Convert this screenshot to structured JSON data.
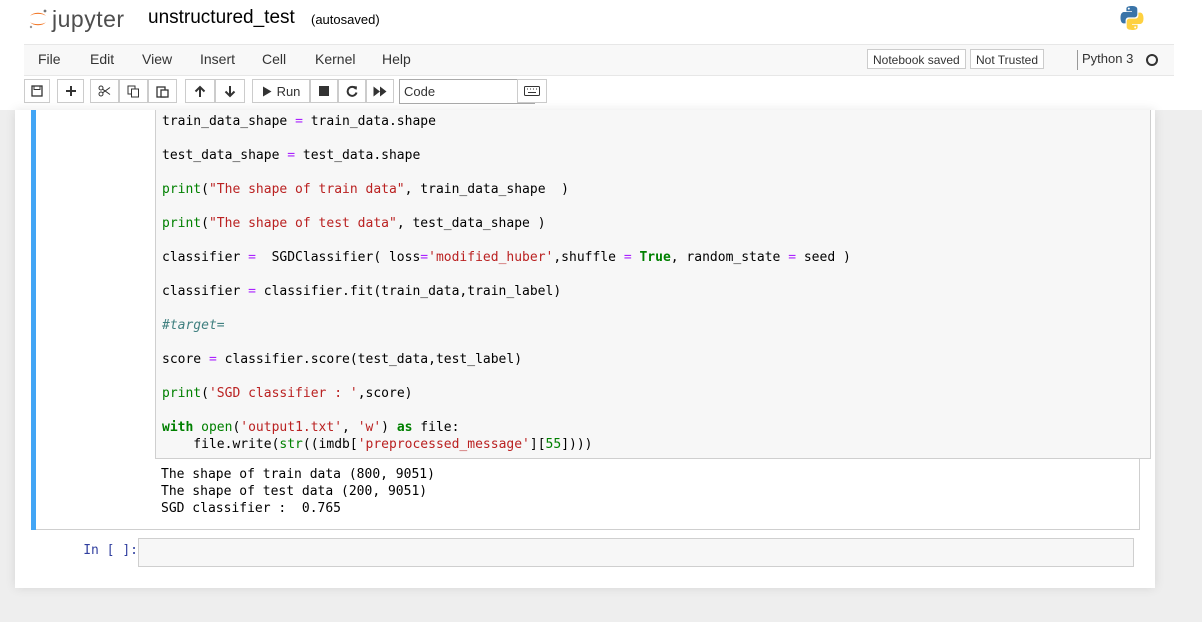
{
  "header": {
    "logo_text": "jupyter",
    "notebook_title": "unstructured_test",
    "autosave_status": "(autosaved)"
  },
  "menubar": {
    "items": [
      "File",
      "Edit",
      "View",
      "Insert",
      "Cell",
      "Kernel",
      "Help"
    ],
    "notebook_saved": "Notebook saved",
    "trust_status": "Not Trusted",
    "kernel_name": "Python 3"
  },
  "toolbar": {
    "run_label": "Run",
    "cell_type": "Code"
  },
  "cells": {
    "code_lines": [
      "train_data_shape = train_data.shape",
      "test_data_shape = test_data.shape",
      "print(\"The shape of train data\", train_data_shape  )",
      "print(\"The shape of test data\", test_data_shape )",
      "classifier =  SGDClassifier( loss='modified_huber',shuffle = True, random_state = seed )",
      "classifier = classifier.fit(train_data,train_label)",
      "#target=",
      "score = classifier.score(test_data,test_label)",
      "print('SGD classifier : ',score)",
      "with open('output1.txt', 'w') as file:",
      "    file.write(str((imdb['preprocessed_message'][55])))"
    ],
    "output_lines": [
      "The shape of train data (800, 9051)",
      "The shape of test data (200, 9051)",
      "SGD classifier :  0.765"
    ],
    "empty_prompt": "In [ ]:"
  },
  "colors": {
    "selected_bar": "#42a5f5",
    "prompt": "#303f9f",
    "keyword": "#008000",
    "string": "#ba2121",
    "operator": "#aa22ff"
  }
}
